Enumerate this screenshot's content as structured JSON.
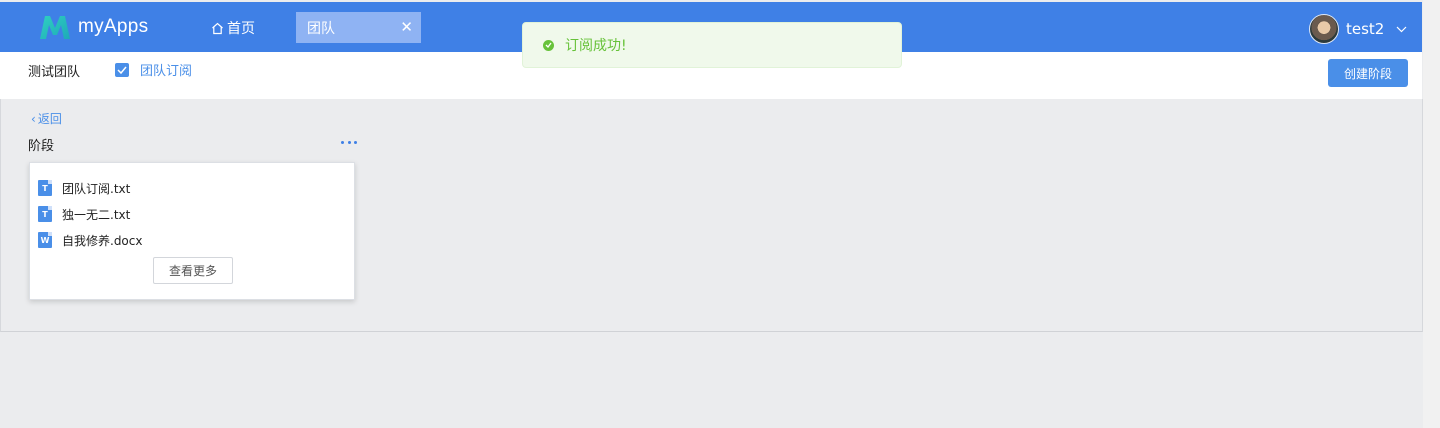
{
  "app": {
    "name": "myApps"
  },
  "colors": {
    "primary": "#3f80e6",
    "accent": "#4a8fe8",
    "success": "#67c23a"
  },
  "nav": {
    "home_label": "首页",
    "home_icon": "home-icon",
    "active_tab": {
      "label": "团队",
      "close_icon": "close-icon"
    }
  },
  "user": {
    "name": "test2",
    "avatar": "avatar",
    "dropdown_icon": "chevron-down-icon"
  },
  "toast": {
    "message": "订阅成功!",
    "icon": "success-check-icon"
  },
  "subbar": {
    "team_name": "测试团队",
    "subscribe": {
      "label": "团队订阅",
      "checked": true
    },
    "create_button": "创建阶段"
  },
  "content": {
    "back_label": "返回",
    "stage": {
      "title": "阶段",
      "more_icon": "more-horizontal-icon",
      "files": [
        {
          "name": "团队订阅.txt",
          "type": "txt",
          "icon_letter": "T"
        },
        {
          "name": "独一无二.txt",
          "type": "txt",
          "icon_letter": "T"
        },
        {
          "name": "自我修养.docx",
          "type": "docx",
          "icon_letter": "W"
        }
      ],
      "view_more": "查看更多"
    }
  }
}
